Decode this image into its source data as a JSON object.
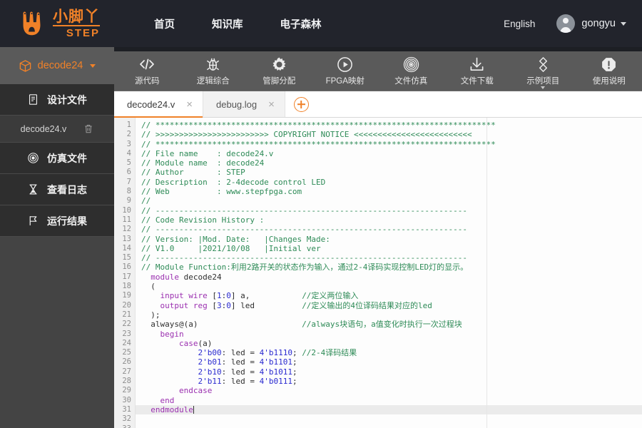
{
  "topnav": {
    "logo_cn": "小脚丫",
    "logo_en": "STEP",
    "logo_icon": "paw-footprint-icon",
    "links": [
      {
        "label": "首页",
        "name": "nav-home"
      },
      {
        "label": "知识库",
        "name": "nav-knowledge-base"
      },
      {
        "label": "电子森林",
        "name": "nav-electronic-forest"
      }
    ],
    "language": "English",
    "username": "gongyu"
  },
  "sidebar": {
    "project_name": "decode24",
    "project_icon": "cube-icon",
    "items": [
      {
        "label": "设计文件",
        "icon": "document-icon",
        "name": "sidebar-item-design-files"
      },
      {
        "label": "仿真文件",
        "icon": "target-icon",
        "name": "sidebar-item-simulation-files"
      },
      {
        "label": "查看日志",
        "icon": "hourglass-icon",
        "name": "sidebar-item-view-log"
      },
      {
        "label": "运行结果",
        "icon": "flag-icon",
        "name": "sidebar-item-run-result"
      }
    ],
    "design_file": {
      "label": "decode24.v",
      "delete_icon": "trash-icon"
    }
  },
  "toolbar": {
    "items": [
      {
        "label": "源代码",
        "icon": "code-brackets-icon",
        "name": "toolbar-source-code",
        "caret": false
      },
      {
        "label": "逻辑综合",
        "icon": "bug-icon",
        "name": "toolbar-logic-synthesis",
        "caret": false
      },
      {
        "label": "管脚分配",
        "icon": "gear-icon",
        "name": "toolbar-pin-assignment",
        "caret": false
      },
      {
        "label": "FPGA映射",
        "icon": "play-circle-icon",
        "name": "toolbar-fpga-mapping",
        "caret": false
      },
      {
        "label": "文件仿真",
        "icon": "concentric-circles-icon",
        "name": "toolbar-file-simulation",
        "caret": false
      },
      {
        "label": "文件下载",
        "icon": "download-icon",
        "name": "toolbar-file-download",
        "caret": false
      },
      {
        "label": "示例项目",
        "icon": "diamonds-icon",
        "name": "toolbar-example-projects",
        "caret": true
      },
      {
        "label": "使用说明",
        "icon": "octagon-exclamation-icon",
        "name": "toolbar-instructions",
        "caret": false
      }
    ]
  },
  "tabs": {
    "items": [
      {
        "label": "decode24.v",
        "active": true,
        "name": "tab-decode24-v"
      },
      {
        "label": "debug.log",
        "active": false,
        "name": "tab-debug-log"
      }
    ],
    "close_glyph": "×",
    "add_tab_icon": "plus-circle-icon"
  },
  "editor": {
    "active_line": 33,
    "total_lines": 33,
    "colors": {
      "comment": "#2e8b57",
      "keyword": "#9b30b0",
      "number": "#2a2ad0",
      "text": "#2f2f2f",
      "accent": "#f08128",
      "gutter_bg": "#f0f0f0",
      "editor_bg": "#fdfdfd"
    },
    "lines": [
      {
        "n": 1,
        "tokens": [
          {
            "t": "cm",
            "v": "// ************************************************************************"
          }
        ]
      },
      {
        "n": 2,
        "tokens": [
          {
            "t": "cm",
            "v": "// >>>>>>>>>>>>>>>>>>>>>>>> COPYRIGHT NOTICE <<<<<<<<<<<<<<<<<<<<<<<<<"
          }
        ]
      },
      {
        "n": 3,
        "tokens": [
          {
            "t": "cm",
            "v": "// ************************************************************************"
          }
        ]
      },
      {
        "n": 4,
        "tokens": [
          {
            "t": "cm",
            "v": "// File name    : decode24.v"
          }
        ]
      },
      {
        "n": 5,
        "tokens": [
          {
            "t": "cm",
            "v": "// Module name  : decode24"
          }
        ]
      },
      {
        "n": 6,
        "tokens": [
          {
            "t": "cm",
            "v": "// Author       : STEP"
          }
        ]
      },
      {
        "n": 7,
        "tokens": [
          {
            "t": "cm",
            "v": "// Description  : 2-4decode control LED"
          }
        ]
      },
      {
        "n": 8,
        "tokens": [
          {
            "t": "cm",
            "v": "// Web          : www.stepfpga.com"
          }
        ]
      },
      {
        "n": 9,
        "tokens": [
          {
            "t": "cm",
            "v": "//"
          }
        ]
      },
      {
        "n": 10,
        "tokens": [
          {
            "t": "cm",
            "v": "// ------------------------------------------------------------------"
          }
        ]
      },
      {
        "n": 11,
        "tokens": [
          {
            "t": "cm",
            "v": "// Code Revision History :"
          }
        ]
      },
      {
        "n": 12,
        "tokens": [
          {
            "t": "cm",
            "v": "// ------------------------------------------------------------------"
          }
        ]
      },
      {
        "n": 13,
        "tokens": [
          {
            "t": "cm",
            "v": "// Version: |Mod. Date:   |Changes Made:"
          }
        ]
      },
      {
        "n": 14,
        "tokens": [
          {
            "t": "cm",
            "v": "// V1.0     |2021/10/08   |Initial ver"
          }
        ]
      },
      {
        "n": 15,
        "tokens": [
          {
            "t": "cm",
            "v": "// ------------------------------------------------------------------"
          }
        ]
      },
      {
        "n": 16,
        "tokens": [
          {
            "t": "cm",
            "v": "// Module Function:利用2路开关的状态作为输入，通过2-4译码实现控制LED灯的显示。"
          }
        ]
      },
      {
        "n": 17,
        "tokens": [
          {
            "t": "id",
            "v": ""
          }
        ]
      },
      {
        "n": 18,
        "tokens": [
          {
            "t": "kw",
            "v": "  module "
          },
          {
            "t": "id",
            "v": "decode24"
          }
        ]
      },
      {
        "n": 19,
        "tokens": [
          {
            "t": "id",
            "v": "  ("
          }
        ]
      },
      {
        "n": 20,
        "tokens": [
          {
            "t": "kw",
            "v": "    input wire "
          },
          {
            "t": "id",
            "v": "["
          },
          {
            "t": "num",
            "v": "1"
          },
          {
            "t": "id",
            "v": ":"
          },
          {
            "t": "num",
            "v": "0"
          },
          {
            "t": "id",
            "v": "] a,           "
          },
          {
            "t": "cm",
            "v": "//定义两位输入"
          }
        ]
      },
      {
        "n": 21,
        "tokens": [
          {
            "t": "kw",
            "v": "    output reg "
          },
          {
            "t": "id",
            "v": "["
          },
          {
            "t": "num",
            "v": "3"
          },
          {
            "t": "id",
            "v": ":"
          },
          {
            "t": "num",
            "v": "0"
          },
          {
            "t": "id",
            "v": "] led          "
          },
          {
            "t": "cm",
            "v": "//定义输出的4位译码结果对应的led"
          }
        ]
      },
      {
        "n": 22,
        "tokens": [
          {
            "t": "id",
            "v": "  );"
          }
        ]
      },
      {
        "n": 23,
        "tokens": [
          {
            "t": "id",
            "v": ""
          }
        ]
      },
      {
        "n": 24,
        "tokens": [
          {
            "t": "id",
            "v": "  always@(a)                      "
          },
          {
            "t": "cm",
            "v": "//always块语句，a值变化时执行一次过程块"
          }
        ]
      },
      {
        "n": 25,
        "tokens": [
          {
            "t": "kw",
            "v": "    begin"
          }
        ]
      },
      {
        "n": 26,
        "tokens": [
          {
            "t": "kw",
            "v": "        case"
          },
          {
            "t": "id",
            "v": "(a)"
          }
        ]
      },
      {
        "n": 27,
        "tokens": [
          {
            "t": "num",
            "v": "            2'b00"
          },
          {
            "t": "id",
            "v": ": led = "
          },
          {
            "t": "num",
            "v": "4'b1110"
          },
          {
            "t": "id",
            "v": "; "
          },
          {
            "t": "cm",
            "v": "//2-4译码结果"
          }
        ]
      },
      {
        "n": 28,
        "tokens": [
          {
            "t": "num",
            "v": "            2'b01"
          },
          {
            "t": "id",
            "v": ": led = "
          },
          {
            "t": "num",
            "v": "4'b1101"
          },
          {
            "t": "id",
            "v": ";"
          }
        ]
      },
      {
        "n": 29,
        "tokens": [
          {
            "t": "num",
            "v": "            2'b10"
          },
          {
            "t": "id",
            "v": ": led = "
          },
          {
            "t": "num",
            "v": "4'b1011"
          },
          {
            "t": "id",
            "v": ";"
          }
        ]
      },
      {
        "n": 30,
        "tokens": [
          {
            "t": "num",
            "v": "            2'b11"
          },
          {
            "t": "id",
            "v": ": led = "
          },
          {
            "t": "num",
            "v": "4'b0111"
          },
          {
            "t": "id",
            "v": ";"
          }
        ]
      },
      {
        "n": 31,
        "tokens": [
          {
            "t": "kw",
            "v": "        endcase"
          }
        ]
      },
      {
        "n": 32,
        "tokens": [
          {
            "t": "kw",
            "v": "    end"
          }
        ]
      },
      {
        "n": 33,
        "tokens": [
          {
            "t": "kw",
            "v": "  endmodule"
          }
        ]
      }
    ]
  }
}
